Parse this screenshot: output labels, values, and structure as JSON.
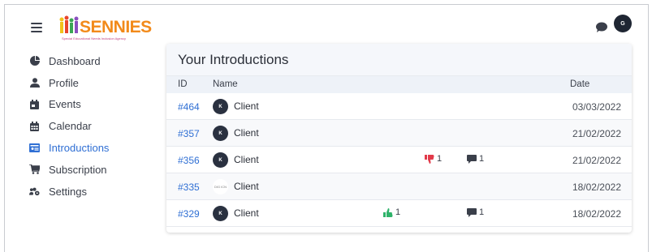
{
  "app": {
    "logo_text": "SENNIES",
    "logo_tagline": "Special Educational Needs Inclusion Agency",
    "user_initial": "G"
  },
  "sidebar": {
    "items": [
      {
        "label": "Dashboard",
        "icon": "pie-chart-icon",
        "active": false
      },
      {
        "label": "Profile",
        "icon": "user-icon",
        "active": false
      },
      {
        "label": "Events",
        "icon": "calendar-event-icon",
        "active": false
      },
      {
        "label": "Calendar",
        "icon": "calendar-icon",
        "active": false
      },
      {
        "label": "Introductions",
        "icon": "id-card-icon",
        "active": true
      },
      {
        "label": "Subscription",
        "icon": "cart-icon",
        "active": false
      },
      {
        "label": "Settings",
        "icon": "users-cog-icon",
        "active": false
      }
    ]
  },
  "main": {
    "title": "Your Introductions",
    "columns": {
      "id": "ID",
      "name": "Name",
      "date": "Date"
    },
    "rows": [
      {
        "id": "#464",
        "avatar": "K",
        "name": "Client",
        "date": "03/03/2022",
        "thumbs_up": null,
        "thumbs_down": null,
        "comments": null
      },
      {
        "id": "#357",
        "avatar": "K",
        "name": "Client",
        "date": "21/02/2022",
        "thumbs_up": null,
        "thumbs_down": null,
        "comments": null
      },
      {
        "id": "#356",
        "avatar": "K",
        "name": "Client",
        "date": "21/02/2022",
        "thumbs_up": null,
        "thumbs_down": "1",
        "comments": "1"
      },
      {
        "id": "#335",
        "avatar": "logo",
        "avatar_text": "DIG ICN",
        "name": "Client",
        "date": "18/02/2022",
        "thumbs_up": null,
        "thumbs_down": null,
        "comments": null
      },
      {
        "id": "#329",
        "avatar": "K",
        "name": "Client",
        "date": "18/02/2022",
        "thumbs_up": "1",
        "thumbs_down": null,
        "comments": "1"
      }
    ]
  },
  "colors": {
    "accent": "#2f6fd4",
    "thumbs_up": "#2fb36a",
    "thumbs_down": "#e23a4a",
    "logo_orange": "#f28a1a"
  }
}
